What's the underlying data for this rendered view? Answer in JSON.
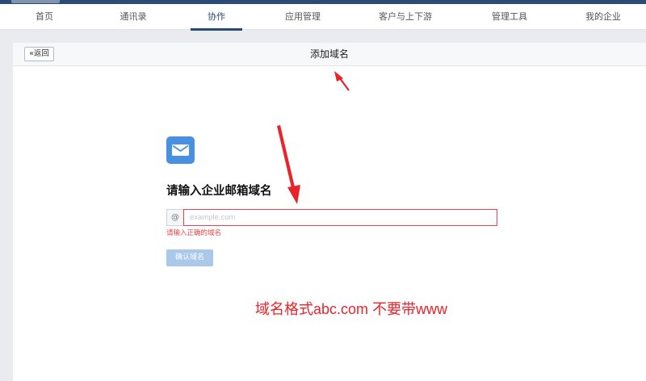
{
  "nav": {
    "items": [
      {
        "label": "首页"
      },
      {
        "label": "通讯录"
      },
      {
        "label": "协作"
      },
      {
        "label": "应用管理"
      },
      {
        "label": "客户与上下游"
      },
      {
        "label": "管理工具"
      },
      {
        "label": "我的企业"
      }
    ],
    "active_index": 2
  },
  "header": {
    "back_label": "«返回",
    "title": "添加域名"
  },
  "form": {
    "heading": "请输入企业邮箱域名",
    "at_symbol": "@",
    "input_value": "",
    "input_placeholder": "example.com",
    "error_message": "请输入正确的域名",
    "confirm_label": "确认域名"
  },
  "annotation": {
    "note": "域名格式abc.com   不要带www",
    "color": "#e8232a"
  },
  "colors": {
    "nav_accent": "#2b4a75",
    "icon_blue": "#4a90e2",
    "error_red": "#e0474c",
    "button_disabled": "#a9c8ea"
  },
  "icons": {
    "mail": "mail-icon",
    "arrow": "arrow-annotation-icon"
  }
}
